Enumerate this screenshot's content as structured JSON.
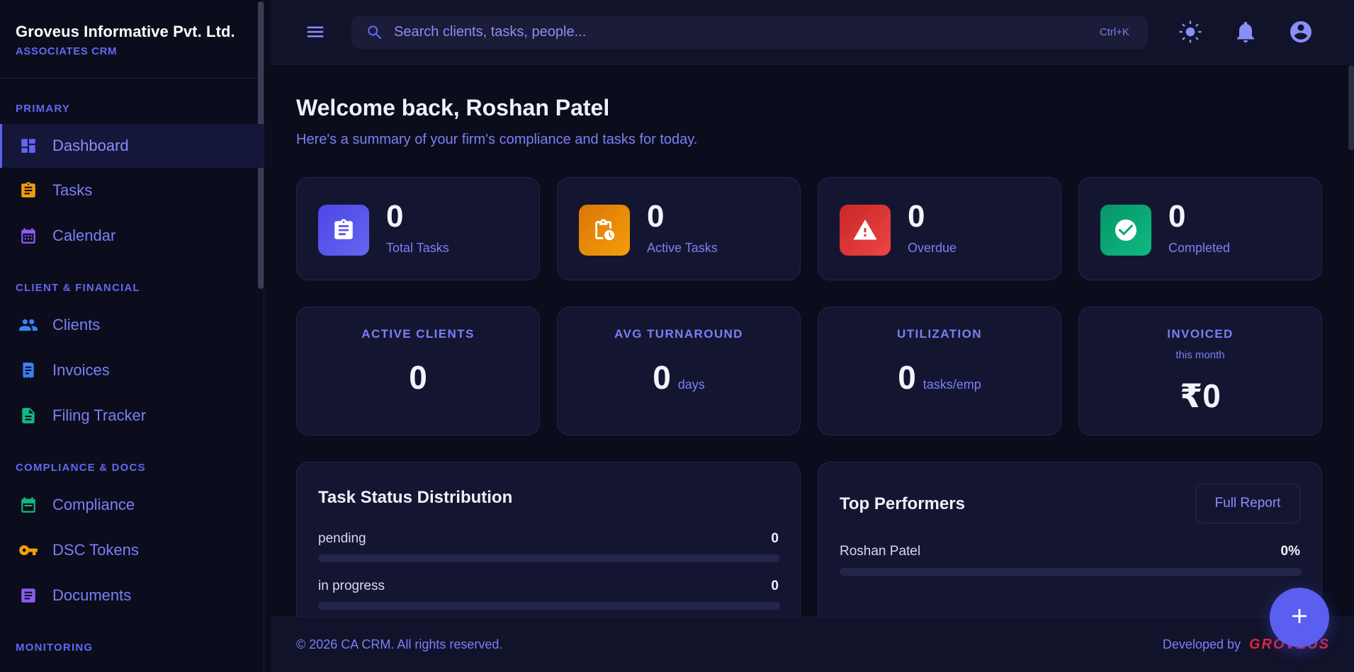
{
  "brand": {
    "title": "Groveus Informative Pvt. Ltd.",
    "subtitle": "ASSOCIATES CRM"
  },
  "sidebar": {
    "sections": [
      {
        "label": "PRIMARY"
      },
      {
        "label": "CLIENT & FINANCIAL"
      },
      {
        "label": "COMPLIANCE & DOCS"
      },
      {
        "label": "MONITORING"
      }
    ],
    "items": [
      {
        "label": "Dashboard",
        "icon": "dashboard-icon",
        "color": "#6366f1",
        "active": true
      },
      {
        "label": "Tasks",
        "icon": "clipboard-icon",
        "color": "#f59e0b"
      },
      {
        "label": "Calendar",
        "icon": "calendar-icon",
        "color": "#8b5cf6"
      },
      {
        "label": "Clients",
        "icon": "people-icon",
        "color": "#3b82f6"
      },
      {
        "label": "Invoices",
        "icon": "invoice-icon",
        "color": "#3b82f6"
      },
      {
        "label": "Filing Tracker",
        "icon": "file-icon",
        "color": "#10b981"
      },
      {
        "label": "Compliance",
        "icon": "calendar-check-icon",
        "color": "#10b981"
      },
      {
        "label": "DSC Tokens",
        "icon": "key-icon",
        "color": "#f59e0b"
      },
      {
        "label": "Documents",
        "icon": "document-icon",
        "color": "#8b5cf6"
      }
    ]
  },
  "header": {
    "search_placeholder": "Search clients, tasks, people...",
    "shortcut": "Ctrl+K"
  },
  "main": {
    "welcome": "Welcome back, Roshan Patel",
    "subtitle": "Here's a summary of your firm's compliance and tasks for today.",
    "stats": [
      {
        "value": "0",
        "label": "Total Tasks",
        "icon": "clipboard-list-icon",
        "color": "#5b5fef"
      },
      {
        "value": "0",
        "label": "Active Tasks",
        "icon": "clipboard-clock-icon",
        "color": "#e98a0c"
      },
      {
        "value": "0",
        "label": "Overdue",
        "icon": "warning-icon",
        "color": "#dc2f35"
      },
      {
        "value": "0",
        "label": "Completed",
        "icon": "check-circle-icon",
        "color": "#10a46a"
      }
    ],
    "metrics": [
      {
        "title": "ACTIVE CLIENTS",
        "value": "0",
        "unit": ""
      },
      {
        "title": "AVG TURNAROUND",
        "value": "0",
        "unit": "days"
      },
      {
        "title": "UTILIZATION",
        "value": "0",
        "unit": "tasks/emp"
      },
      {
        "title": "INVOICED",
        "sub": "this month",
        "value": "₹0",
        "unit": ""
      }
    ],
    "task_status": {
      "title": "Task Status Distribution",
      "rows": [
        {
          "label": "pending",
          "value": "0",
          "fraction": 0
        },
        {
          "label": "in progress",
          "value": "0",
          "fraction": 0
        }
      ]
    },
    "top_performers": {
      "title": "Top Performers",
      "button": "Full Report",
      "rows": [
        {
          "name": "Roshan Patel",
          "value": "0%",
          "fraction": 0
        }
      ]
    }
  },
  "footer": {
    "copyright": "© 2026 CA CRM. All rights reserved.",
    "developed_by": "Developed by",
    "logo": "GROVEUS"
  }
}
